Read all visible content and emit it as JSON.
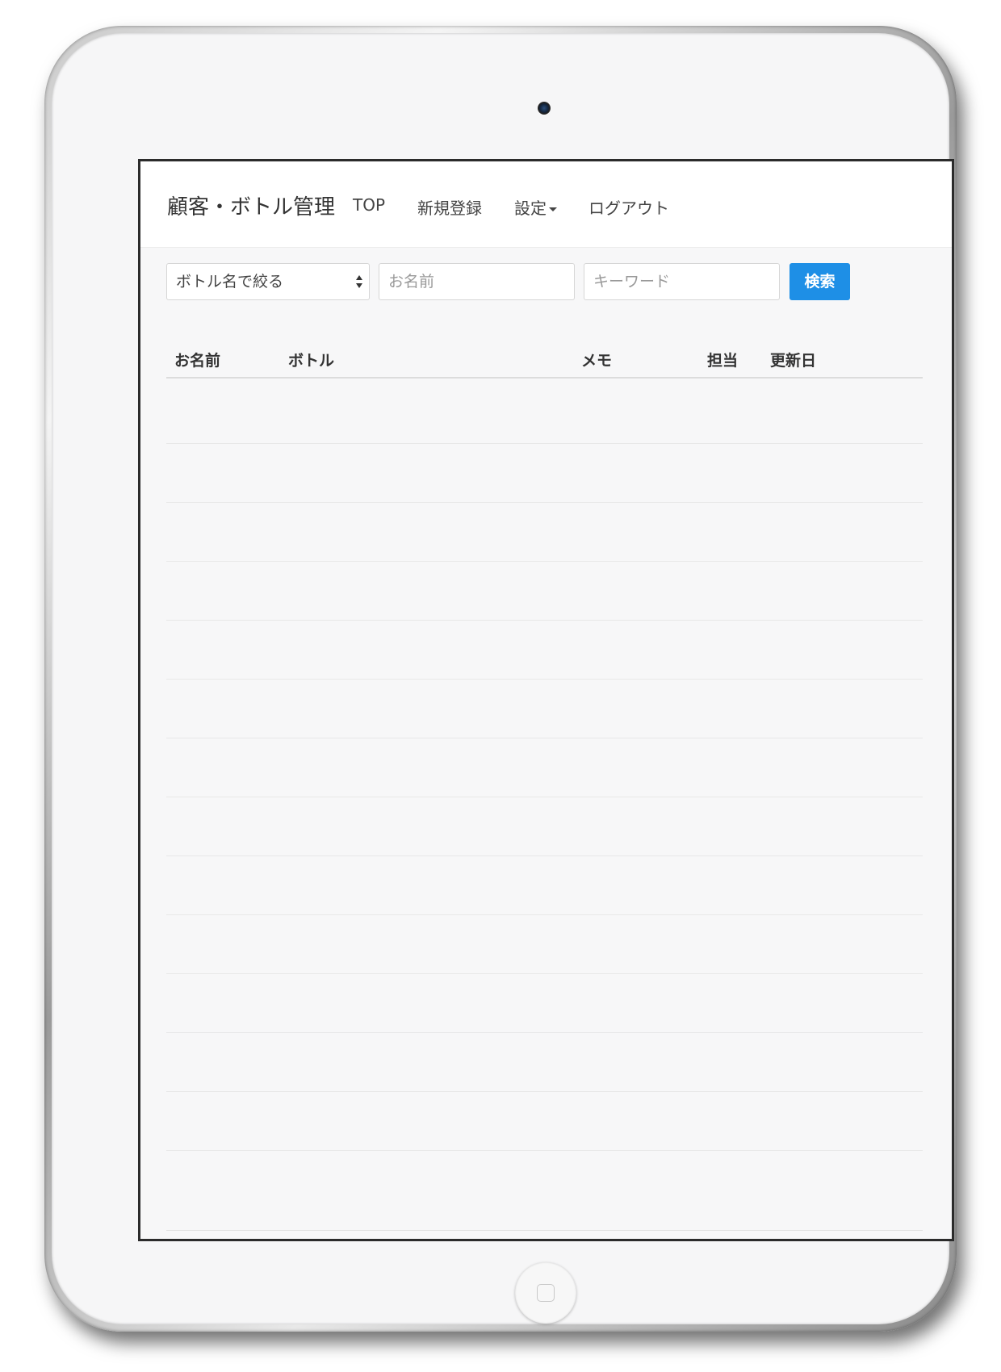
{
  "app": {
    "brand": "顧客・ボトル管理"
  },
  "nav": {
    "top": "TOP",
    "register": "新規登録",
    "settings": "設定",
    "logout": "ログアウト"
  },
  "filters": {
    "bottle_select_value": "ボトル名で絞る",
    "name_placeholder": "お名前",
    "keyword_placeholder": "キーワード",
    "search_button": "検索"
  },
  "table": {
    "headers": {
      "name": "お名前",
      "bottle": "ボトル",
      "memo": "メモ",
      "staff": "担当",
      "updated": "更新日"
    },
    "rows": [
      {
        "name": "",
        "kana": "",
        "bottle": "",
        "memo": "",
        "staff": "",
        "updated": ""
      },
      {
        "name": "",
        "kana": "",
        "bottle": "",
        "memo": "",
        "staff": "",
        "updated": ""
      },
      {
        "name": "",
        "kana": "",
        "bottle": "",
        "memo": "",
        "staff": "",
        "updated": ""
      },
      {
        "name": "",
        "kana": "",
        "bottle": "",
        "memo": "",
        "staff": "",
        "updated": ""
      },
      {
        "name": "",
        "kana": "",
        "bottle": "",
        "memo": "",
        "staff": "",
        "updated": ""
      },
      {
        "name": "",
        "kana": "",
        "bottle": "",
        "memo": "",
        "staff": "",
        "updated": ""
      },
      {
        "name": "",
        "kana": "",
        "bottle": "",
        "memo": "",
        "staff": "",
        "updated": ""
      },
      {
        "name": "",
        "kana": "",
        "bottle": "",
        "memo": "",
        "staff": "",
        "updated": ""
      },
      {
        "name": "",
        "kana": "",
        "bottle": "",
        "memo": "",
        "staff": "",
        "updated": ""
      },
      {
        "name": "",
        "kana": "",
        "bottle": "",
        "memo": "",
        "staff": "",
        "updated": ""
      },
      {
        "name": "",
        "kana": "",
        "bottle": "",
        "memo": "",
        "staff": "",
        "updated": ""
      },
      {
        "name": "",
        "kana": "",
        "bottle": "",
        "memo": "",
        "staff": "",
        "updated": ""
      },
      {
        "name": "",
        "kana": "",
        "bottle": "",
        "memo": "",
        "staff": "",
        "updated": ""
      }
    ]
  },
  "colors": {
    "accent": "#1e8fe6",
    "link": "#3b95e8",
    "device_bezel": "#f6f6f7"
  },
  "icons": {
    "select_arrows": "select-arrows-icon",
    "dropdown_caret": "caret-down-icon",
    "home": "home-button-icon",
    "camera": "camera-icon"
  }
}
